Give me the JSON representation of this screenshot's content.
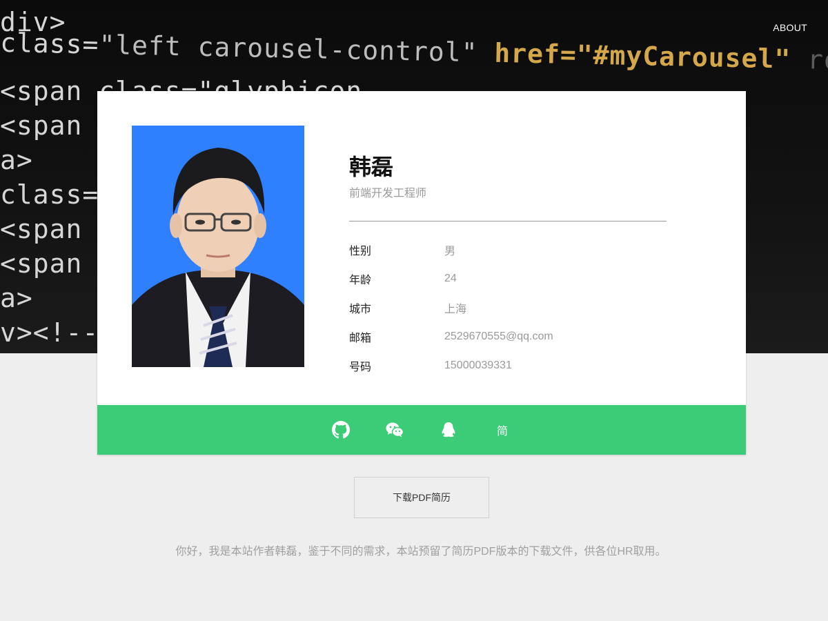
{
  "nav": {
    "about_label": "ABOUT"
  },
  "hero": {
    "code_lines": [
      {
        "parts": [
          {
            "t": "div>",
            "c": "attr"
          }
        ]
      },
      {
        "parts": [
          {
            "t": " class=",
            "c": "attr"
          },
          {
            "t": "\"left carousel-control\" ",
            "c": "str"
          },
          {
            "t": "href=",
            "c": "kw"
          },
          {
            "t": "\"#myCarousel\"",
            "c": "kw"
          },
          {
            "t": " role=\"button\" data-slide=\"prev\">",
            "c": "dim"
          }
        ]
      },
      {
        "parts": [
          {
            "t": "<span class=\"glyphicon",
            "c": "attr"
          }
        ]
      },
      {
        "parts": [
          {
            "t": "<span c",
            "c": "attr"
          }
        ]
      },
      {
        "parts": [
          {
            "t": "a>",
            "c": "attr"
          }
        ]
      },
      {
        "parts": [
          {
            "t": " class=",
            "c": "attr"
          }
        ]
      },
      {
        "parts": [
          {
            "t": "<span c",
            "c": "attr"
          }
        ]
      },
      {
        "parts": [
          {
            "t": "<span c",
            "c": "attr"
          }
        ]
      },
      {
        "parts": [
          {
            "t": "a>",
            "c": "attr"
          }
        ]
      },
      {
        "parts": [
          {
            "t": "v><!--",
            "c": "attr"
          },
          {
            "t": " -",
            "c": "dim"
          }
        ]
      }
    ]
  },
  "profile": {
    "name": "韩磊",
    "role": "前端开发工程师",
    "fields": [
      {
        "key": "性别",
        "value": "男"
      },
      {
        "key": "年龄",
        "value": "24"
      },
      {
        "key": "城市",
        "value": "上海"
      },
      {
        "key": "邮箱",
        "value": "2529670555@qq.com"
      },
      {
        "key": "号码",
        "value": "15000039331"
      }
    ]
  },
  "social": {
    "icons": [
      "github-icon",
      "wechat-icon",
      "qq-icon"
    ],
    "resume_label": "简"
  },
  "download": {
    "label": "下载PDF简历"
  },
  "note": "你好，我是本站作者韩磊，鉴于不同的需求，本站预留了简历PDF版本的下载文件，供各位HR取用。",
  "colors": {
    "accent": "#3ccc78",
    "photo_bg": "#2f80ff",
    "page_bg": "#eeeeee"
  }
}
